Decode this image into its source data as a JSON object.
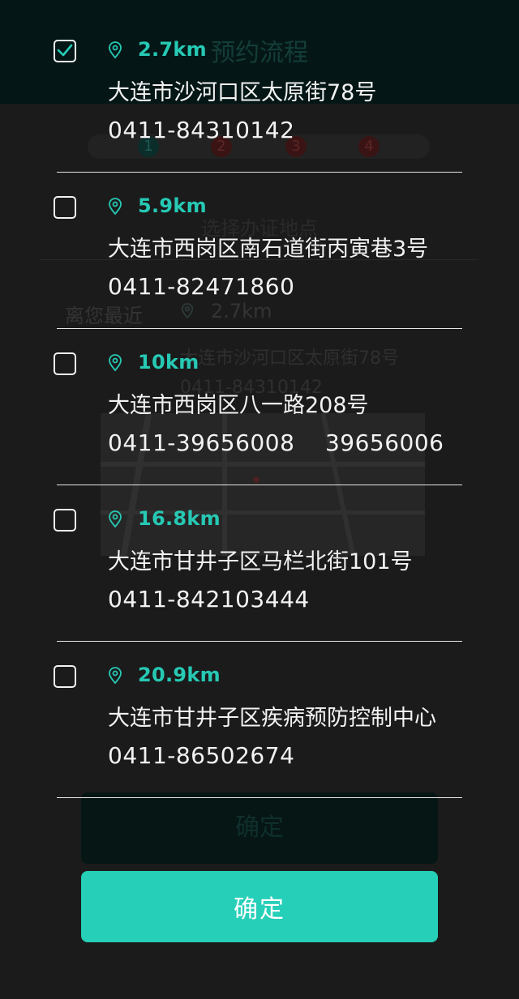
{
  "background": {
    "header_title": "预约流程",
    "steps": [
      "1",
      "2",
      "3",
      "4"
    ],
    "section_title": "选择办证地点",
    "nearest_label": "离您最近",
    "nearest_distance": "2.7km",
    "nearest_address": "大连市沙河口区太原街78号",
    "nearest_phone": "0411-84310142",
    "confirm_label": "确定"
  },
  "locations": [
    {
      "checked": true,
      "distance": "2.7km",
      "address": "大连市沙河口区太原街78号",
      "phone": "0411-84310142"
    },
    {
      "checked": false,
      "distance": "5.9km",
      "address": "大连市西岗区南石道街丙寅巷3号",
      "phone": "0411-82471860"
    },
    {
      "checked": false,
      "distance": "10km",
      "address": "大连市西岗区八一路208号",
      "phone": "0411-39656008    39656006"
    },
    {
      "checked": false,
      "distance": "16.8km",
      "address": "大连市甘井子区马栏北街101号",
      "phone": "0411-842103444"
    },
    {
      "checked": false,
      "distance": "20.9km",
      "address": "大连市甘井子区疾病预防控制中心",
      "phone": "0411-86502674"
    }
  ],
  "confirm": {
    "label": "确定"
  },
  "colors": {
    "accent": "#26cfb8",
    "distance_text": "#26c9b4",
    "overlay_bg": "#1b1b1b",
    "text": "#f2f2f2"
  },
  "icons": {
    "location": "map-pin-icon",
    "check": "checkmark-icon"
  }
}
